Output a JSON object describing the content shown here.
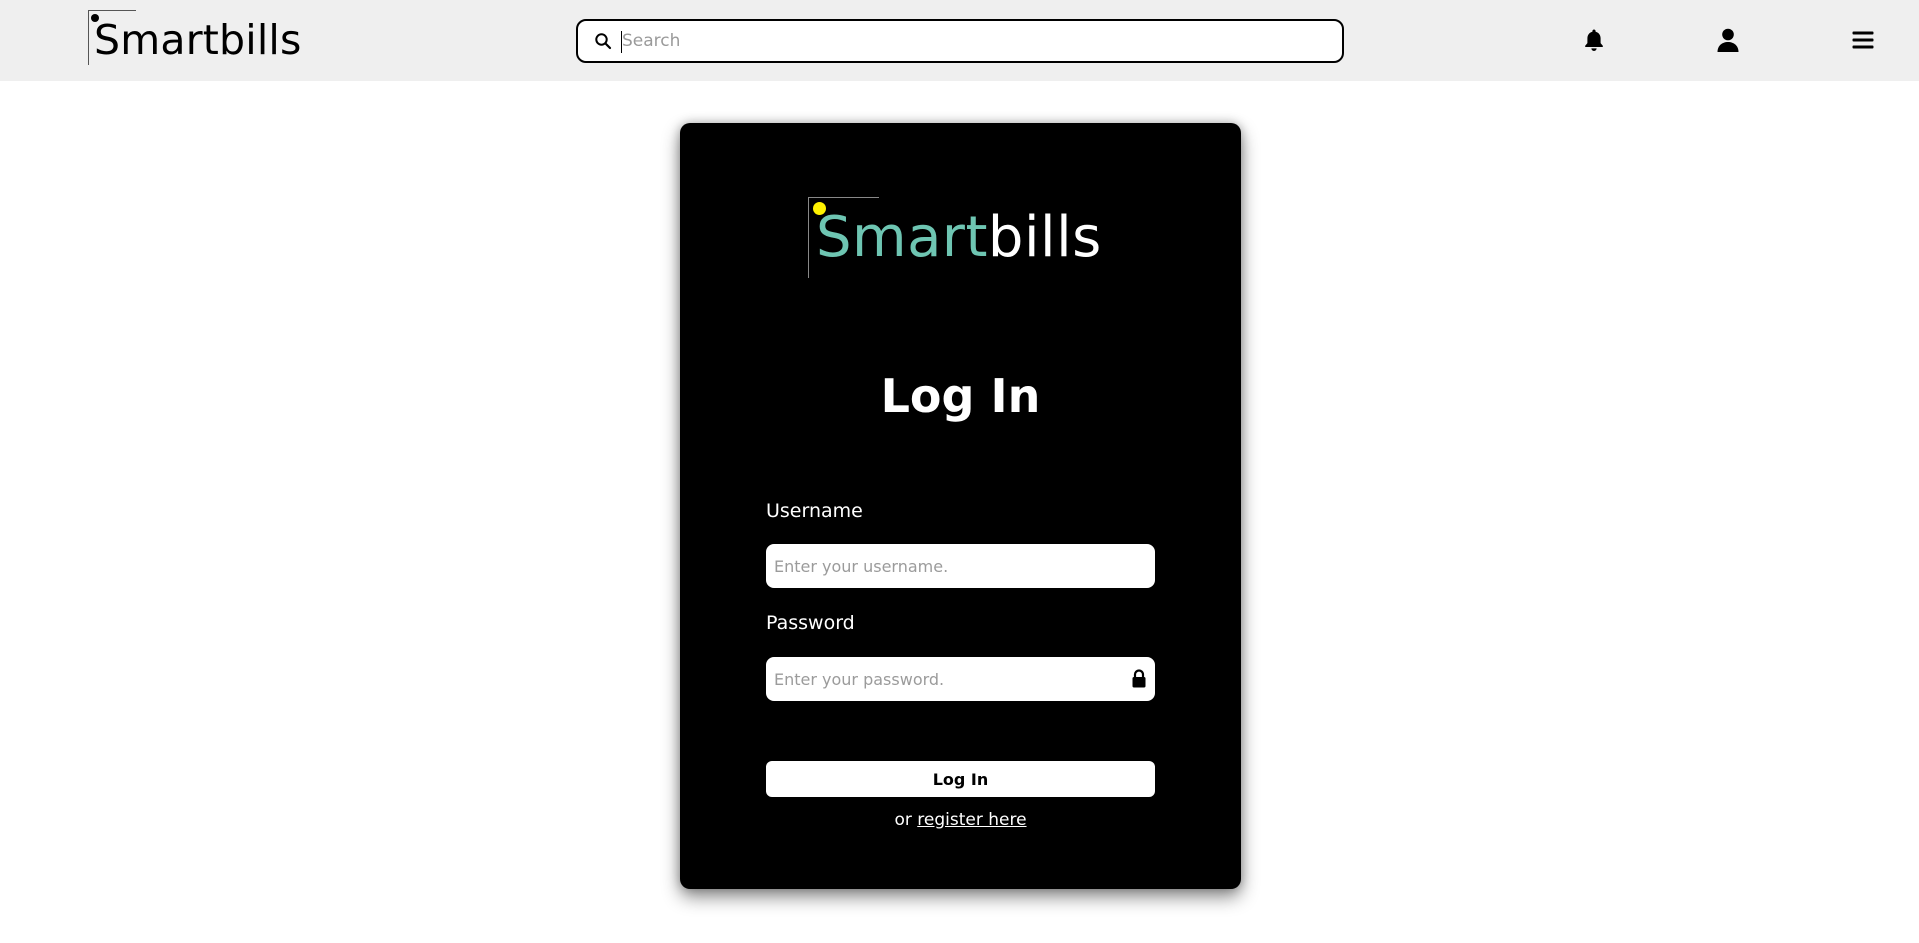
{
  "header": {
    "brand": "Smartbills",
    "search": {
      "placeholder": "Search",
      "value": ""
    },
    "icons": {
      "notifications": "bell-icon",
      "profile": "user-icon",
      "menu": "hamburger-menu-icon"
    }
  },
  "login_card": {
    "logo": {
      "part1": "Smart",
      "part2": "bills"
    },
    "title": "Log In",
    "username": {
      "label": "Username",
      "placeholder": "Enter your username."
    },
    "password": {
      "label": "Password",
      "placeholder": "Enter your password."
    },
    "submit_label": "Log In",
    "register": {
      "prefix": "or",
      "link_text": "register here"
    }
  },
  "colors": {
    "header_bg": "#efefef",
    "card_bg": "#000000",
    "logo_accent": "#6ec5b2",
    "logo_dot": "#fff200"
  }
}
